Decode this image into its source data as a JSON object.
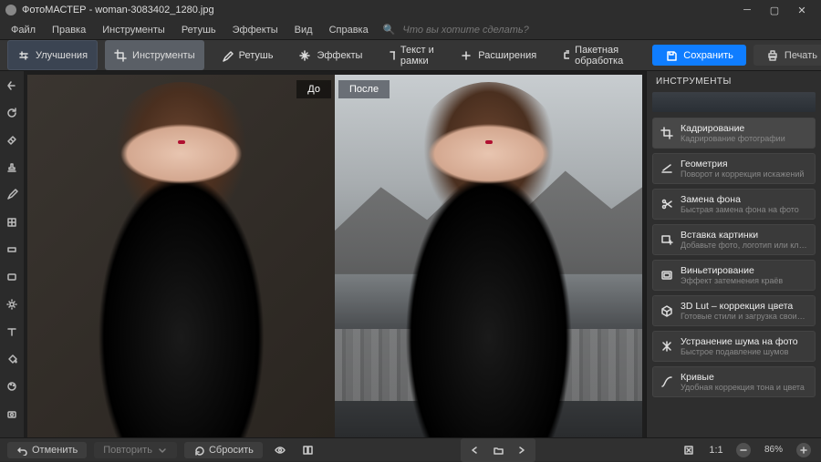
{
  "window": {
    "app": "ФотоМАСТЕР",
    "file": "woman-3083402_1280.jpg"
  },
  "menu": {
    "items": [
      "Файл",
      "Правка",
      "Инструменты",
      "Ретушь",
      "Эффекты",
      "Вид",
      "Справка"
    ],
    "search_hint": "Что вы хотите сделать?"
  },
  "tabs": {
    "improve": "Улучшения",
    "tools": "Инструменты",
    "retouch": "Ретушь",
    "effects": "Эффекты",
    "text": "Текст и рамки",
    "ext": "Расширения",
    "batch": "Пакетная обработка",
    "save": "Сохранить",
    "print": "Печать"
  },
  "canvas": {
    "before": "До",
    "after": "После"
  },
  "right_panel": {
    "title": "ИНСТРУМЕНТЫ",
    "tools": [
      {
        "title": "Кадрирование",
        "desc": "Кадрирование фотографии"
      },
      {
        "title": "Геометрия",
        "desc": "Поворот и коррекция искажений"
      },
      {
        "title": "Замена фона",
        "desc": "Быстрая замена фона на фото"
      },
      {
        "title": "Вставка картинки",
        "desc": "Добавьте фото, логотип или клипарт"
      },
      {
        "title": "Виньетирование",
        "desc": "Эффект затемнения краёв"
      },
      {
        "title": "3D Lut – коррекция цвета",
        "desc": "Готовые стили и загрузка своих пресетов"
      },
      {
        "title": "Устранение шума на фото",
        "desc": "Быстрое подавление шумов"
      },
      {
        "title": "Кривые",
        "desc": "Удобная коррекция тона и цвета"
      }
    ]
  },
  "bottom": {
    "undo": "Отменить",
    "redo": "Повторить",
    "reset": "Сбросить",
    "zoom_ratio": "1:1",
    "zoom_pct": "86%"
  }
}
